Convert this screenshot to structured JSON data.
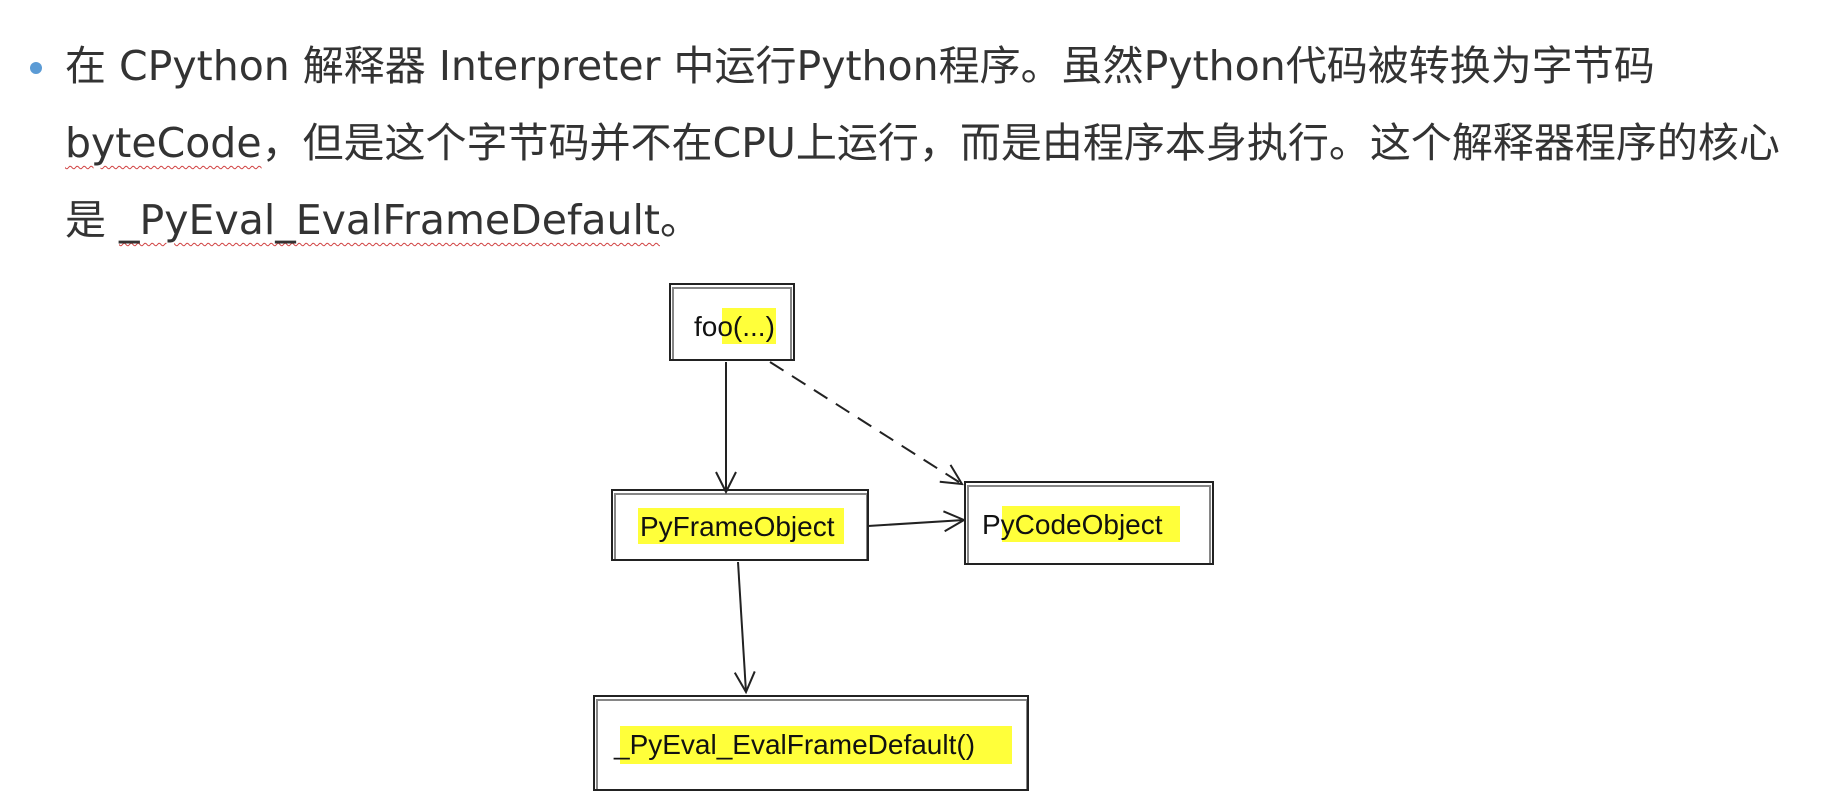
{
  "paragraph": {
    "part1": "在 CPython 解释器 Interpreter 中运行Python程序。虽然Python代码被转换为字节码 ",
    "term_bytecode": "byteCode",
    "part2": "，但是这个字节码并不在CPU上运行，而是由程序本身执行。这个解释器程序的核心是 ",
    "term_evalframe": "_PyEval_EvalFrameDefault",
    "part3": "。"
  },
  "diagram": {
    "nodes": {
      "foo": "foo(...)",
      "frame": "PyFrameObject",
      "code": "PyCodeObject",
      "eval": "_PyEval_EvalFrameDefault()"
    },
    "edges": [
      {
        "from": "foo",
        "to": "frame",
        "style": "solid"
      },
      {
        "from": "foo",
        "to": "code",
        "style": "dashed"
      },
      {
        "from": "frame",
        "to": "code",
        "style": "solid"
      },
      {
        "from": "frame",
        "to": "eval",
        "style": "solid"
      }
    ],
    "colors": {
      "highlight": "#ffff3a",
      "bullet": "#5b9bd5",
      "stroke": "#222222"
    }
  }
}
